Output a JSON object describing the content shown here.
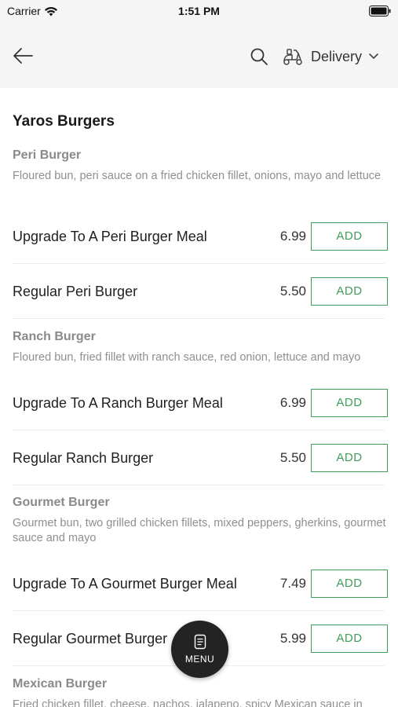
{
  "status_bar": {
    "carrier": "Carrier",
    "time": "1:51 PM"
  },
  "header": {
    "delivery_label": "Delivery"
  },
  "restaurant": {
    "name": "Yaros Burgers"
  },
  "sections": [
    {
      "title": "Peri Burger",
      "description": "Floured bun, peri sauce on a fried chicken fillet, onions, mayo and lettuce",
      "items": [
        {
          "name": "Upgrade To A Peri Burger Meal",
          "price": "6.99",
          "button": "ADD"
        },
        {
          "name": "Regular Peri Burger",
          "price": "5.50",
          "button": "ADD"
        }
      ]
    },
    {
      "title": "Ranch Burger",
      "description": "Floured bun, fried fillet with ranch sauce, red onion, lettuce and mayo",
      "items": [
        {
          "name": "Upgrade To A Ranch Burger Meal",
          "price": "6.99",
          "button": "ADD"
        },
        {
          "name": "Regular Ranch Burger",
          "price": "5.50",
          "button": "ADD"
        }
      ]
    },
    {
      "title": "Gourmet Burger",
      "description": "Gourmet bun, two grilled chicken fillets, mixed peppers, gherkins, gourmet sauce and mayo",
      "items": [
        {
          "name": "Upgrade To A Gourmet Burger Meal",
          "price": "7.49",
          "button": "ADD"
        },
        {
          "name": "Regular Gourmet Burger",
          "price": "5.99",
          "button": "ADD"
        }
      ]
    },
    {
      "title": "Mexican Burger",
      "description": "Fried chicken fillet, cheese, nachos, jalapeno, spicy Mexican sauce in"
    }
  ],
  "menu_button": {
    "label": "MENU"
  },
  "icons": {
    "back": "arrow-left-icon",
    "search": "search-icon",
    "delivery": "scooter-icon",
    "dropdown": "chevron-down-icon",
    "menu": "menu-card-icon",
    "wifi": "wifi-icon",
    "battery": "battery-icon"
  },
  "colors": {
    "accent": "#3f9d5a",
    "header_bg": "#f5f5f5",
    "fab_bg": "#232323"
  }
}
